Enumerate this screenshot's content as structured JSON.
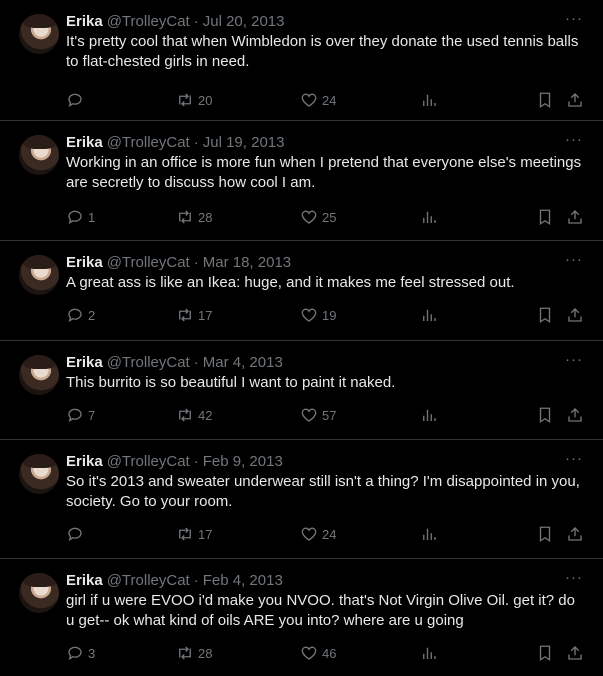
{
  "tweets": [
    {
      "name": "Erika",
      "handle": "@TrolleyCat",
      "date": "Jul 20, 2013",
      "text": "It's pretty cool that when Wimbledon is over they donate the used tennis balls to flat-chested girls in need.",
      "replies": "",
      "retweets": "20",
      "likes": "24"
    },
    {
      "name": "Erika",
      "handle": "@TrolleyCat",
      "date": "Jul 19, 2013",
      "text": "Working in an office is more fun when I pretend that everyone else's meetings are secretly to discuss how cool I am.",
      "replies": "1",
      "retweets": "28",
      "likes": "25"
    },
    {
      "name": "Erika",
      "handle": "@TrolleyCat",
      "date": "Mar 18, 2013",
      "text": "A great ass is like an Ikea: huge, and it makes me feel stressed out.",
      "replies": "2",
      "retweets": "17",
      "likes": "19"
    },
    {
      "name": "Erika",
      "handle": "@TrolleyCat",
      "date": "Mar 4, 2013",
      "text": "This burrito is so beautiful I want to paint it naked.",
      "replies": "7",
      "retweets": "42",
      "likes": "57"
    },
    {
      "name": "Erika",
      "handle": "@TrolleyCat",
      "date": "Feb 9, 2013",
      "text": "So it's 2013 and sweater underwear still isn't a thing? I'm disappointed in you, society. Go to your room.",
      "replies": "",
      "retweets": "17",
      "likes": "24"
    },
    {
      "name": "Erika",
      "handle": "@TrolleyCat",
      "date": "Feb 4, 2013",
      "text": "girl if u were EVOO i'd make you NVOO. that's Not Virgin Olive Oil. get it? do u get-- ok what kind of oils ARE you into? where are u going",
      "replies": "3",
      "retweets": "28",
      "likes": "46"
    }
  ],
  "dot_separator": "·",
  "more_label": "···",
  "icons": {
    "reply": "reply-icon",
    "retweet": "retweet-icon",
    "like": "heart-icon",
    "views": "views-icon",
    "bookmark": "bookmark-icon",
    "share": "share-icon"
  },
  "colors": {
    "background": "#000000",
    "text": "#e7e9ea",
    "muted": "#71767b",
    "border": "#2f3336"
  }
}
